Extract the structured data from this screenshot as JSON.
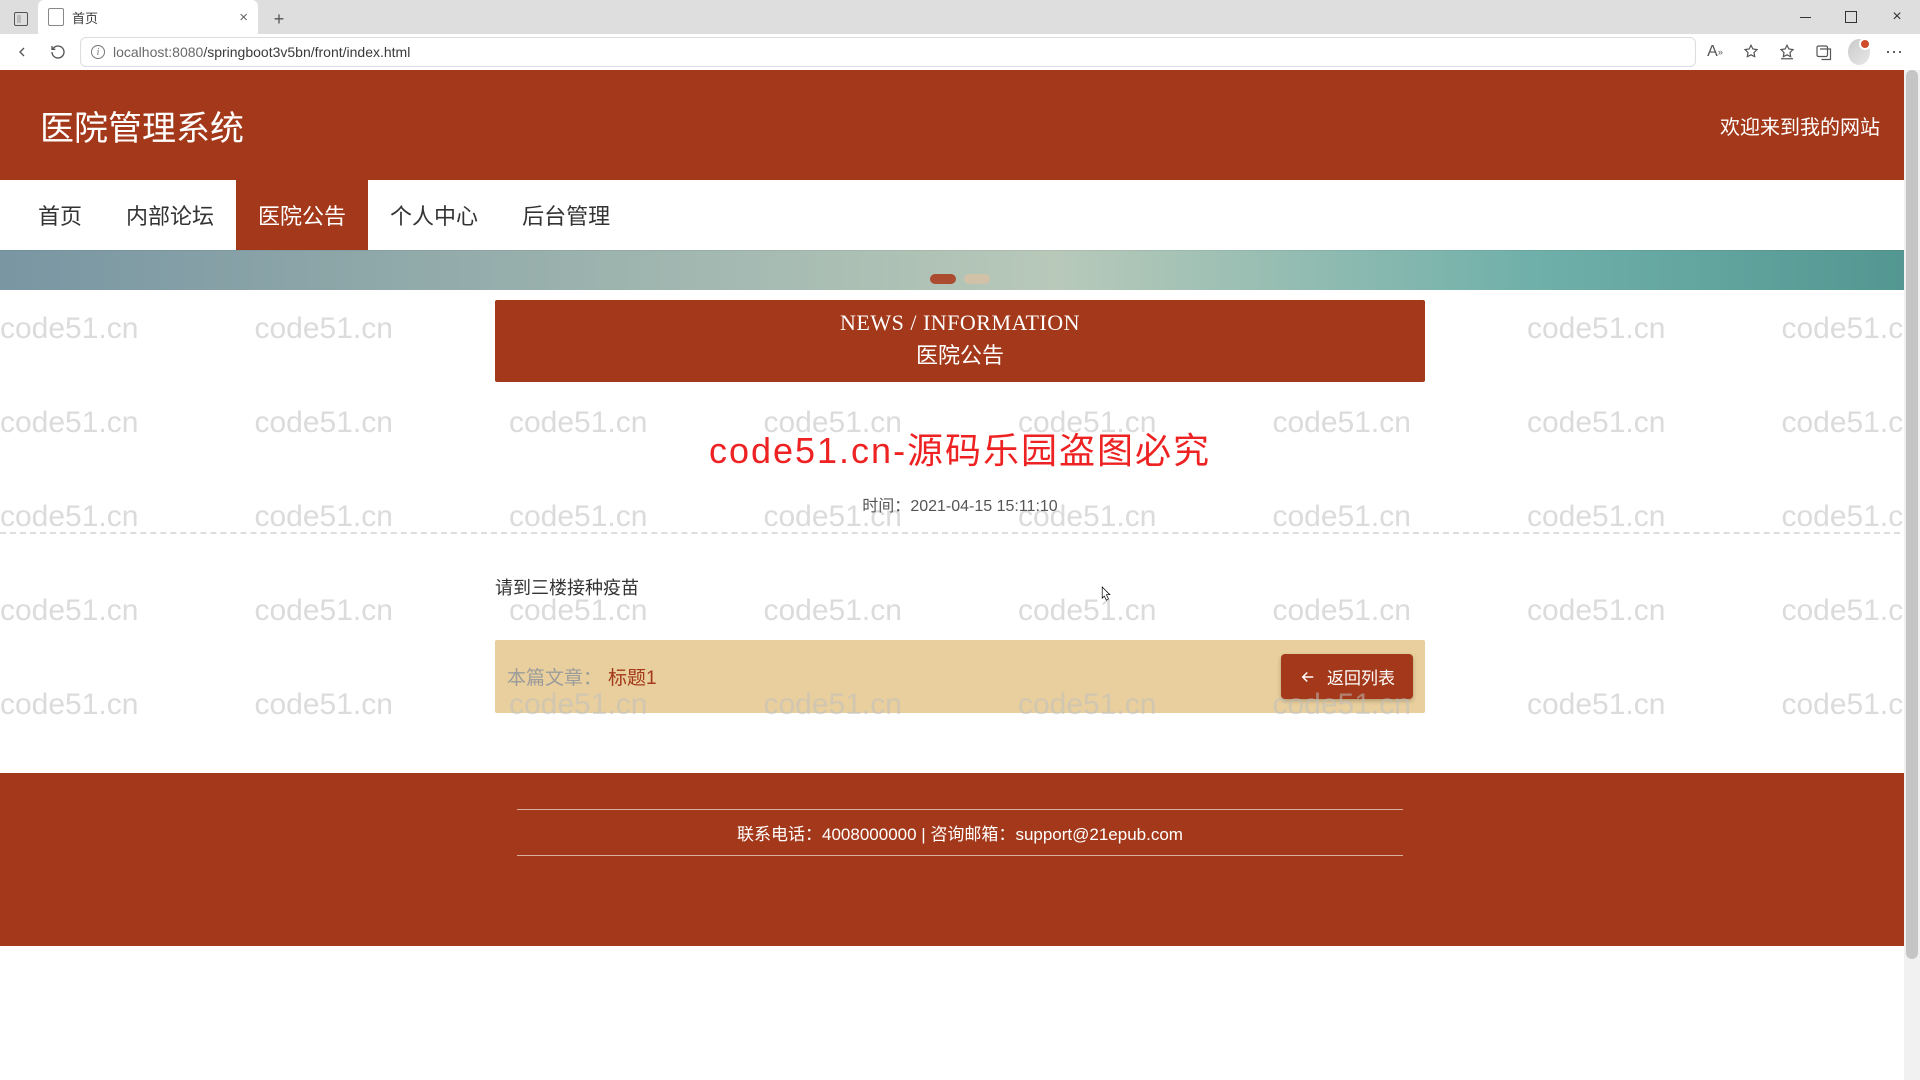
{
  "browser": {
    "tab_title": "首页",
    "url_host": "localhost",
    "url_port": ":8080",
    "url_path": "/springboot3v5bn/front/index.html"
  },
  "header": {
    "site_title": "医院管理系统",
    "welcome": "欢迎来到我的网站"
  },
  "nav": {
    "items": [
      {
        "label": "首页",
        "active": false
      },
      {
        "label": "内部论坛",
        "active": false
      },
      {
        "label": "医院公告",
        "active": true
      },
      {
        "label": "个人中心",
        "active": false
      },
      {
        "label": "后台管理",
        "active": false
      }
    ]
  },
  "section": {
    "eng": "NEWS / INFORMATION",
    "chn": "医院公告"
  },
  "article": {
    "title_overlay": "code51.cn-源码乐园盗图必究",
    "underlying_title": "标题1",
    "time_label": "时间：",
    "time_value": "2021-04-15 15:11:10",
    "body": "请到三楼接种疫苗",
    "footer_label": "本篇文章：",
    "footer_value": "标题1",
    "back_label": "返回列表"
  },
  "footer": {
    "phone_label": "联系电话：",
    "phone": "4008000000",
    "sep": " | ",
    "email_label": "咨询邮箱：",
    "email": "support@21epub.com"
  },
  "watermark_text": "code51.cn",
  "colors": {
    "brand": "#a3391a",
    "accent_bg": "#e8cf9d"
  }
}
